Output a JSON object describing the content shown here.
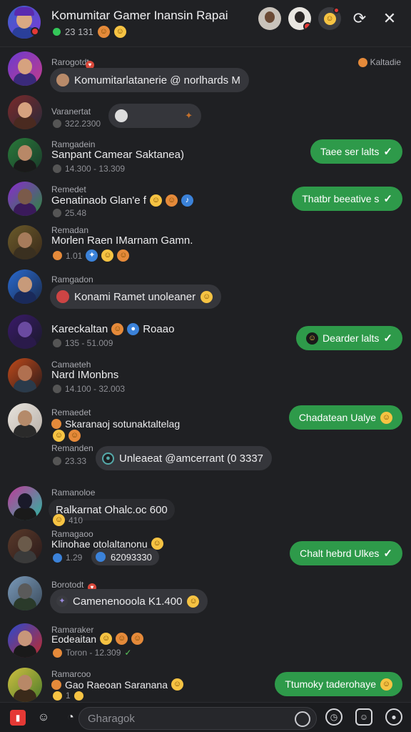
{
  "header": {
    "title": "Komumitar Gamer Inansin Rapai",
    "subtitle": "23 131",
    "colors": {
      "online": "#34c759",
      "accent": "#2e9a4a"
    }
  },
  "messages": [
    {
      "name": "Rarogotdt",
      "text": "",
      "pill": "Komumitarlatanerie @ norlhards M",
      "meta": "",
      "reply": "",
      "side_label": "Kaltadie"
    },
    {
      "name": "Varanertat",
      "text": "",
      "pill": "",
      "meta": "322.2300",
      "reply": ""
    },
    {
      "name": "Ramgadein",
      "text": "Sanpant Camear  Saktanea)",
      "pill": "",
      "meta": "14.300 - 13.309",
      "reply": "Taee ser lalts"
    },
    {
      "name": "Remedet",
      "text": "Genatinaob Glan'e  f",
      "pill": "",
      "meta": "25.48",
      "reply": "Thatbr beeative s"
    },
    {
      "name": "Remadan",
      "text": "Morlen Raen IMarnam Gamn.",
      "pill": "",
      "meta": "1.01",
      "reply": ""
    },
    {
      "name": "Ramgadon",
      "text": "",
      "pill": "Konami Ramet unoleaner",
      "meta": "",
      "reply": ""
    },
    {
      "name": "",
      "text": "Kareckaltan",
      "pill": "",
      "meta": "135 - 51.009",
      "extra": "Roaao",
      "reply": "Dearder lalts"
    },
    {
      "name": "Camaeteh",
      "text": "Nard IMonbns",
      "pill": "",
      "meta": "14.100 - 32.003",
      "reply": ""
    },
    {
      "name": "Remaedet",
      "text": "Skaranaoj sotunaktaltelag",
      "pill": "",
      "meta": "",
      "reply": "Chadatean Ualye"
    },
    {
      "name": "Remanden",
      "text": "",
      "pill": "Unleaeat @amcerrant (0 3337",
      "meta": "23.33",
      "reply": ""
    },
    {
      "name": "Ramanoloe",
      "text": "Ralkarnat Ohalc.oc 600",
      "pill": "",
      "meta": "410",
      "reply": ""
    },
    {
      "name": "Ramagaoo",
      "text": "Klinohae otolaltanonu",
      "pill": "",
      "meta": "1.29",
      "extra": "62093330",
      "reply": "Chalt hebrd Ulkes"
    },
    {
      "name": "Borotodt",
      "text": "",
      "pill": "Camenenooola  K1.400",
      "meta": "",
      "reply": ""
    },
    {
      "name": "Ramaraker",
      "text": "Eodeaitan",
      "pill": "",
      "meta": "Toron - 12.309",
      "reply": ""
    },
    {
      "name": "Ramarcoo",
      "text": "Gao Raeoan  Saranana",
      "pill": "",
      "meta": "1",
      "reply": "Ttumoky taderohaye"
    }
  ],
  "composer": {
    "placeholder": "Gharagok"
  },
  "icons": {
    "close": "close-icon",
    "refresh": "refresh-icon",
    "emoji": "emoji-icon",
    "mic": "mic-icon"
  }
}
